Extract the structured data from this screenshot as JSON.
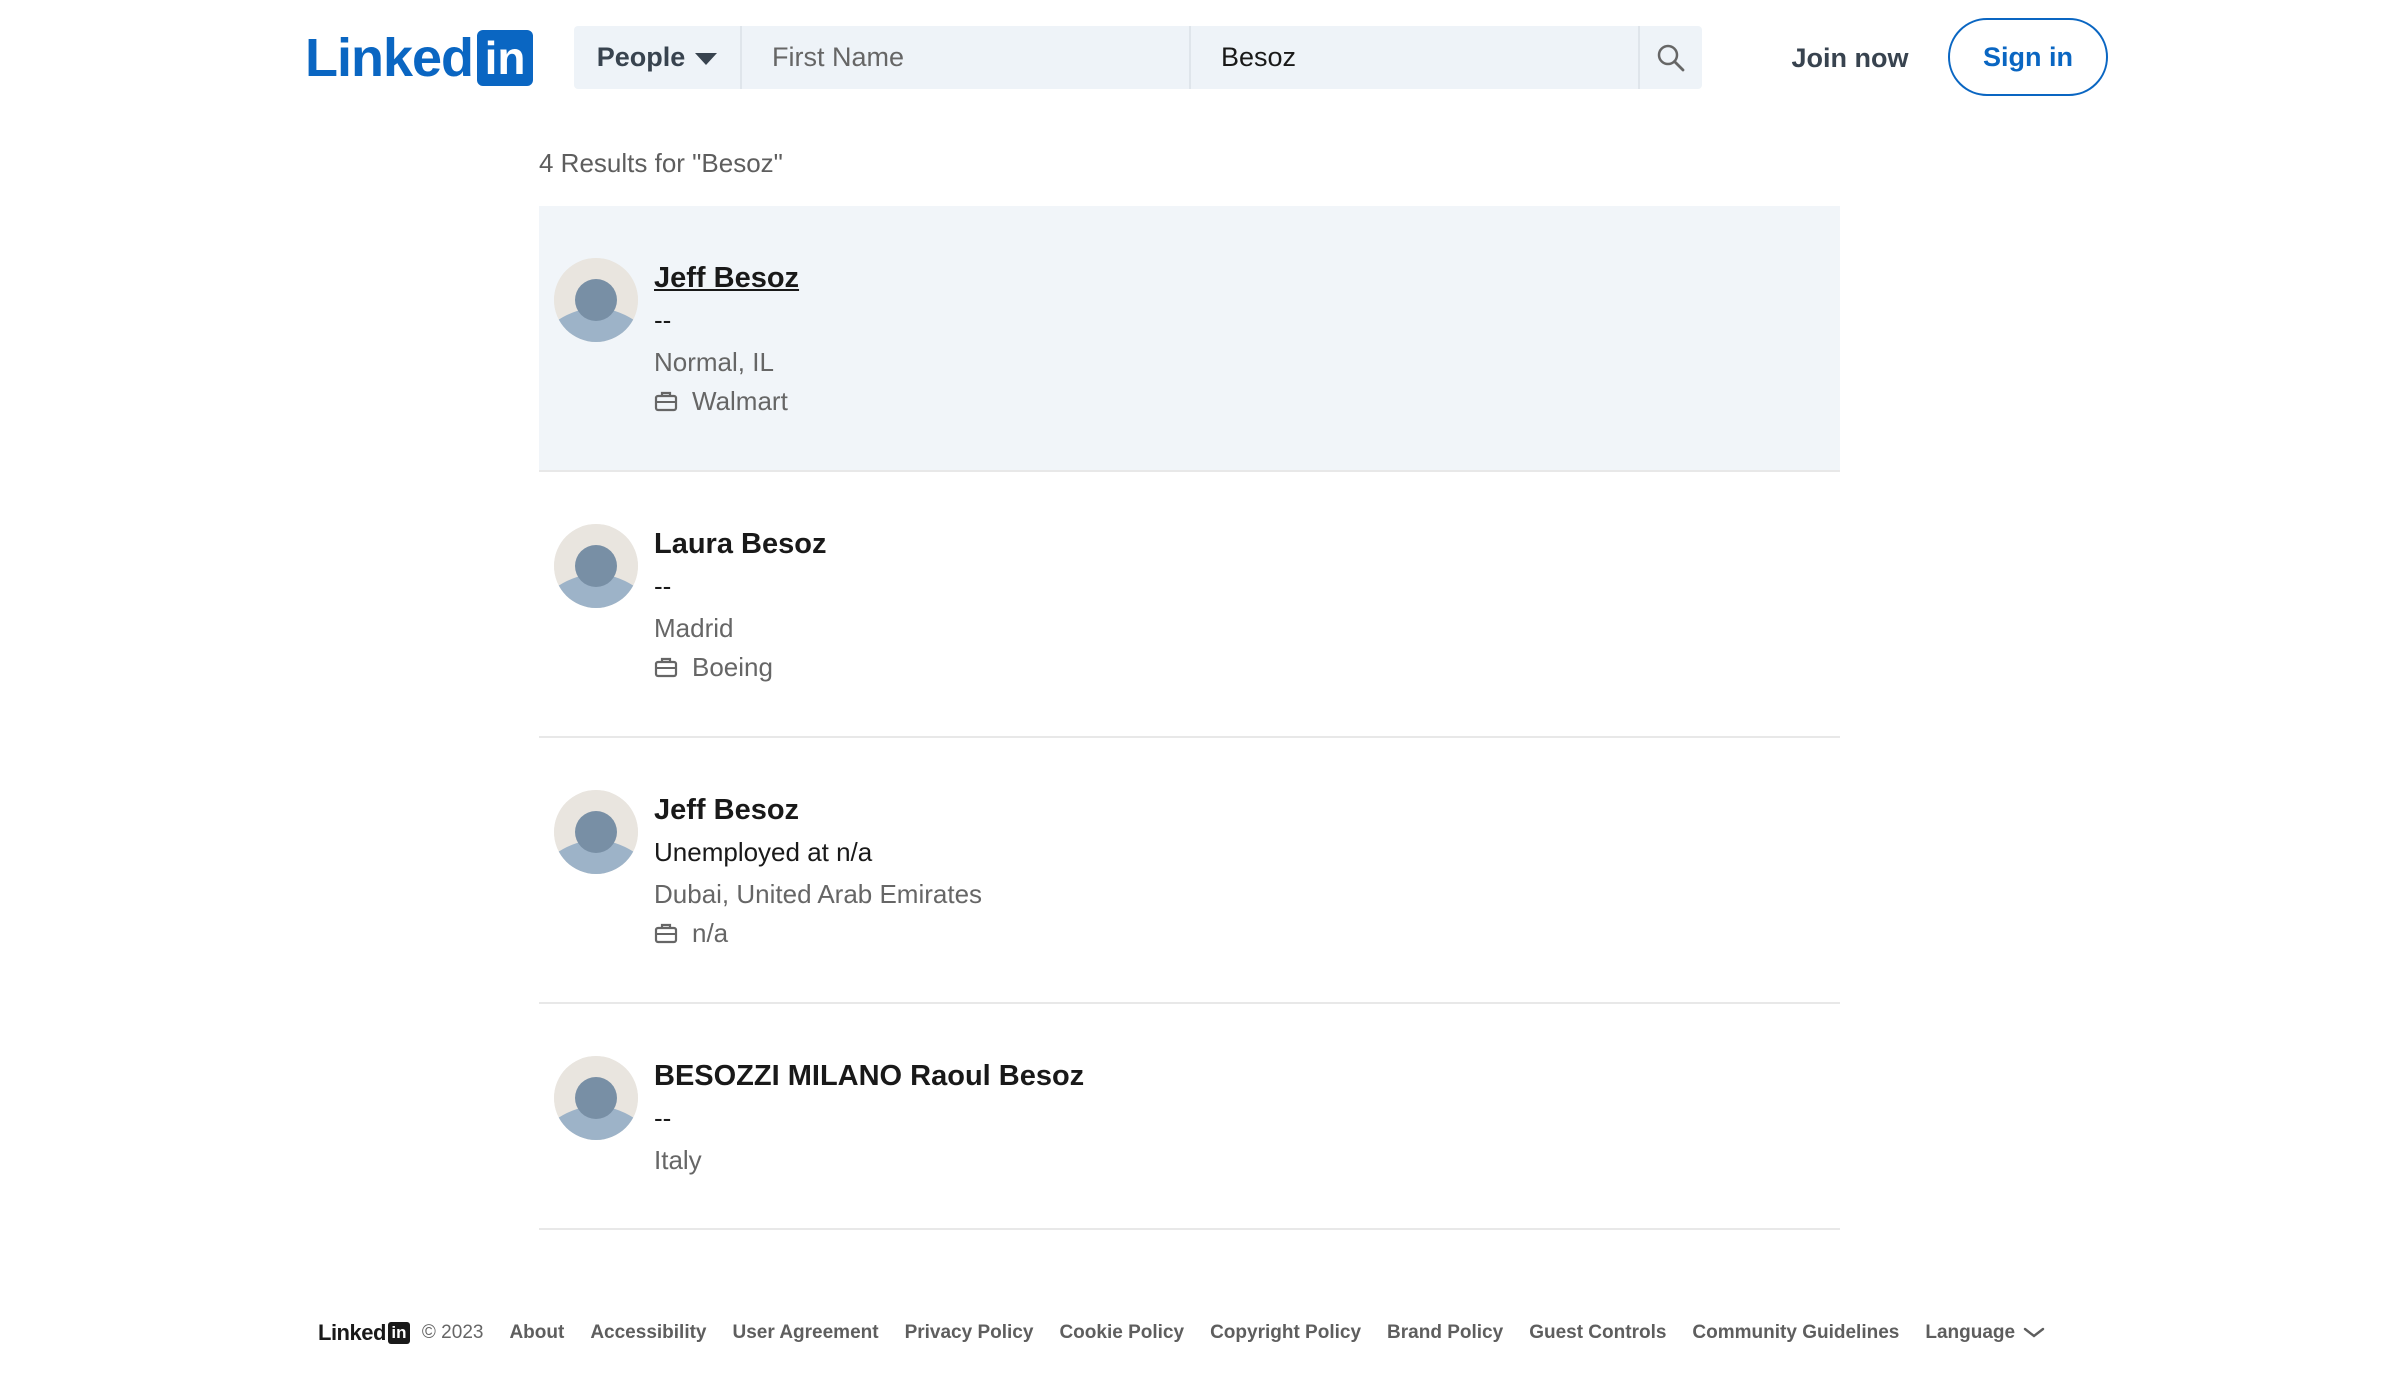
{
  "header": {
    "logo_text": "Linked",
    "logo_box_text": "in",
    "search_type": "People",
    "first_name_placeholder": "First Name",
    "first_name_value": "",
    "last_name_value": "Besoz",
    "join_now": "Join now",
    "sign_in": "Sign in"
  },
  "results": {
    "count_text": "4 Results for \"Besoz\"",
    "items": [
      {
        "name": "Jeff Besoz",
        "headline": "--",
        "location": "Normal, IL",
        "company": "Walmart",
        "highlighted": true
      },
      {
        "name": "Laura Besoz",
        "headline": "--",
        "location": "Madrid",
        "company": "Boeing",
        "highlighted": false
      },
      {
        "name": "Jeff Besoz",
        "headline": "Unemployed at n/a",
        "location": "Dubai, United Arab Emirates",
        "company": "n/a",
        "highlighted": false
      },
      {
        "name": "BESOZZI MILANO Raoul Besoz",
        "headline": "--",
        "location": "Italy",
        "company": null,
        "highlighted": false
      }
    ]
  },
  "footer": {
    "logo_text": "Linked",
    "logo_box_text": "in",
    "copyright": "© 2023",
    "links": [
      "About",
      "Accessibility",
      "User Agreement",
      "Privacy Policy",
      "Cookie Policy",
      "Copyright Policy",
      "Brand Policy",
      "Guest Controls",
      "Community Guidelines"
    ],
    "language": "Language"
  },
  "colors": {
    "brand": "#0a66c2",
    "highlight_bg": "#f1f5f9",
    "search_bg": "#eef3f8"
  },
  "icons": {
    "search": "search-icon",
    "caret": "caret-down-icon",
    "company": "briefcase-icon",
    "avatar": "default-avatar-icon",
    "language": "chevron-down-icon"
  }
}
